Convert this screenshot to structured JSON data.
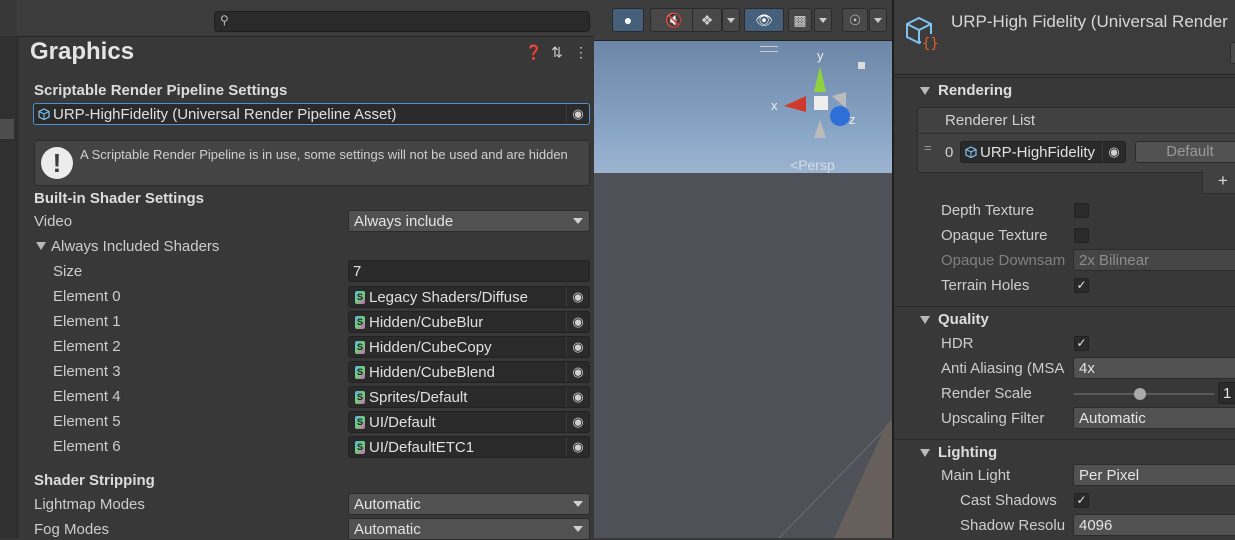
{
  "settings": {
    "title": "Graphics",
    "srp_section": "Scriptable Render Pipeline Settings",
    "srp_asset": "URP-HighFidelity (Universal Render Pipeline Asset)",
    "help_message": "A Scriptable Render Pipeline is in use, some settings will not be used and are hidden",
    "builtin_section": "Built-in Shader Settings",
    "video_label": "Video",
    "video_value": "Always include",
    "always_included_label": "Always Included Shaders",
    "size_label": "Size",
    "size_value": "7",
    "elements": [
      {
        "label": "Element 0",
        "value": "Legacy Shaders/Diffuse"
      },
      {
        "label": "Element 1",
        "value": "Hidden/CubeBlur"
      },
      {
        "label": "Element 2",
        "value": "Hidden/CubeCopy"
      },
      {
        "label": "Element 3",
        "value": "Hidden/CubeBlend"
      },
      {
        "label": "Element 4",
        "value": "Sprites/Default"
      },
      {
        "label": "Element 5",
        "value": "UI/Default"
      },
      {
        "label": "Element 6",
        "value": "UI/DefaultETC1"
      }
    ],
    "stripping_section": "Shader Stripping",
    "lightmap_label": "Lightmap Modes",
    "lightmap_value": "Automatic",
    "fog_label": "Fog Modes",
    "fog_value": "Automatic"
  },
  "scene": {
    "gizmo_y": "y",
    "gizmo_x": "x",
    "gizmo_z": "z",
    "persp": "Persp"
  },
  "inspector": {
    "asset_title": "URP-High Fidelity (Universal Render",
    "rendering": "Rendering",
    "renderer_list": "Renderer List",
    "renderer_index": "0",
    "renderer_value": "URP-HighFidelity",
    "default_button": "Default",
    "add_button": "+",
    "depth_texture": "Depth Texture",
    "opaque_texture": "Opaque Texture",
    "opaque_downsampling": "Opaque Downsam",
    "opaque_downsampling_value": "2x Bilinear",
    "terrain_holes": "Terrain Holes",
    "quality": "Quality",
    "hdr": "HDR",
    "anti_aliasing": "Anti Aliasing (MSA",
    "anti_aliasing_value": "4x",
    "render_scale": "Render Scale",
    "render_scale_value": "1",
    "upscaling_filter": "Upscaling Filter",
    "upscaling_filter_value": "Automatic",
    "lighting": "Lighting",
    "main_light": "Main Light",
    "main_light_value": "Per Pixel",
    "cast_shadows": "Cast Shadows",
    "shadow_resolution": "Shadow Resolu",
    "shadow_resolution_value": "4096",
    "check": "✓"
  }
}
